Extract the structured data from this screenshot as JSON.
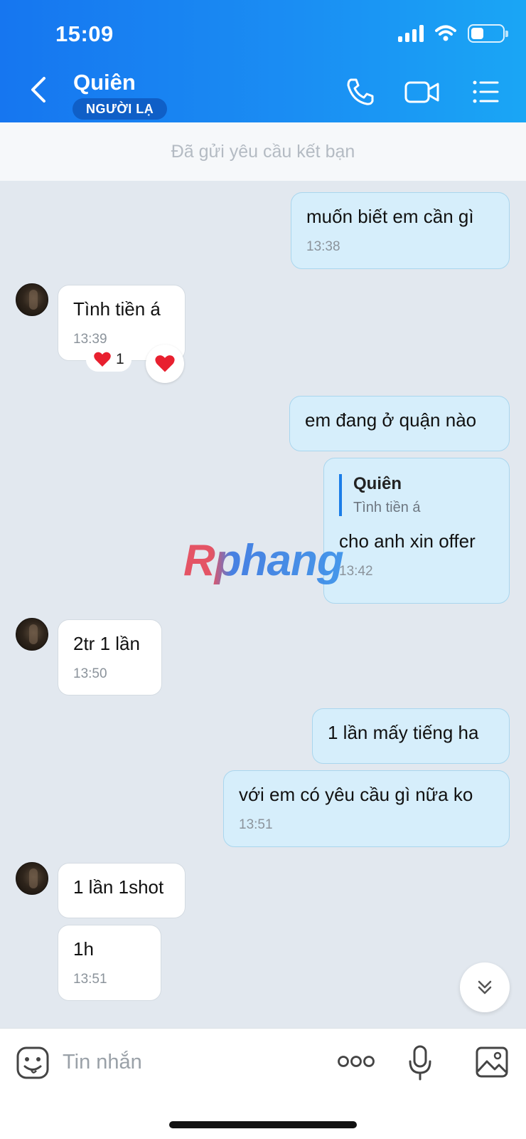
{
  "status_bar": {
    "time": "15:09"
  },
  "header": {
    "contact_name": "Quiên",
    "badge": "NGƯỜI LẠ",
    "icons": [
      "back-arrow-icon",
      "phone-icon",
      "video-call-icon",
      "menu-list-icon"
    ]
  },
  "friend_request": {
    "text": "Đã gửi yêu cầu kết bạn"
  },
  "messages": [
    {
      "dir": "out",
      "text": "muốn biết em cần gì",
      "time": "13:38"
    },
    {
      "dir": "in",
      "text": "Tình tiền á",
      "time": "13:39",
      "reaction": {
        "emoji": "❤️",
        "count": "1"
      }
    },
    {
      "dir": "out",
      "text": "em đang ở quận nào"
    },
    {
      "dir": "out",
      "quote": {
        "name": "Quiên",
        "text": "Tình tiền á"
      },
      "text": "cho anh xin offer",
      "time": "13:42"
    },
    {
      "dir": "in",
      "text": "2tr 1 lần",
      "time": "13:50"
    },
    {
      "dir": "out",
      "text": "1 lần mấy tiếng ha"
    },
    {
      "dir": "out",
      "text": "với em có yêu cầu gì nữa ko",
      "time": "13:51"
    },
    {
      "dir": "in",
      "text": "1 lần 1shot"
    },
    {
      "dir": "in",
      "text": "1h",
      "time": "13:51"
    }
  ],
  "watermark": "Rphang",
  "input_bar": {
    "placeholder": "Tin nhắn",
    "icons": [
      "sticker-icon",
      "more-options-icon",
      "microphone-icon",
      "image-icon"
    ]
  }
}
